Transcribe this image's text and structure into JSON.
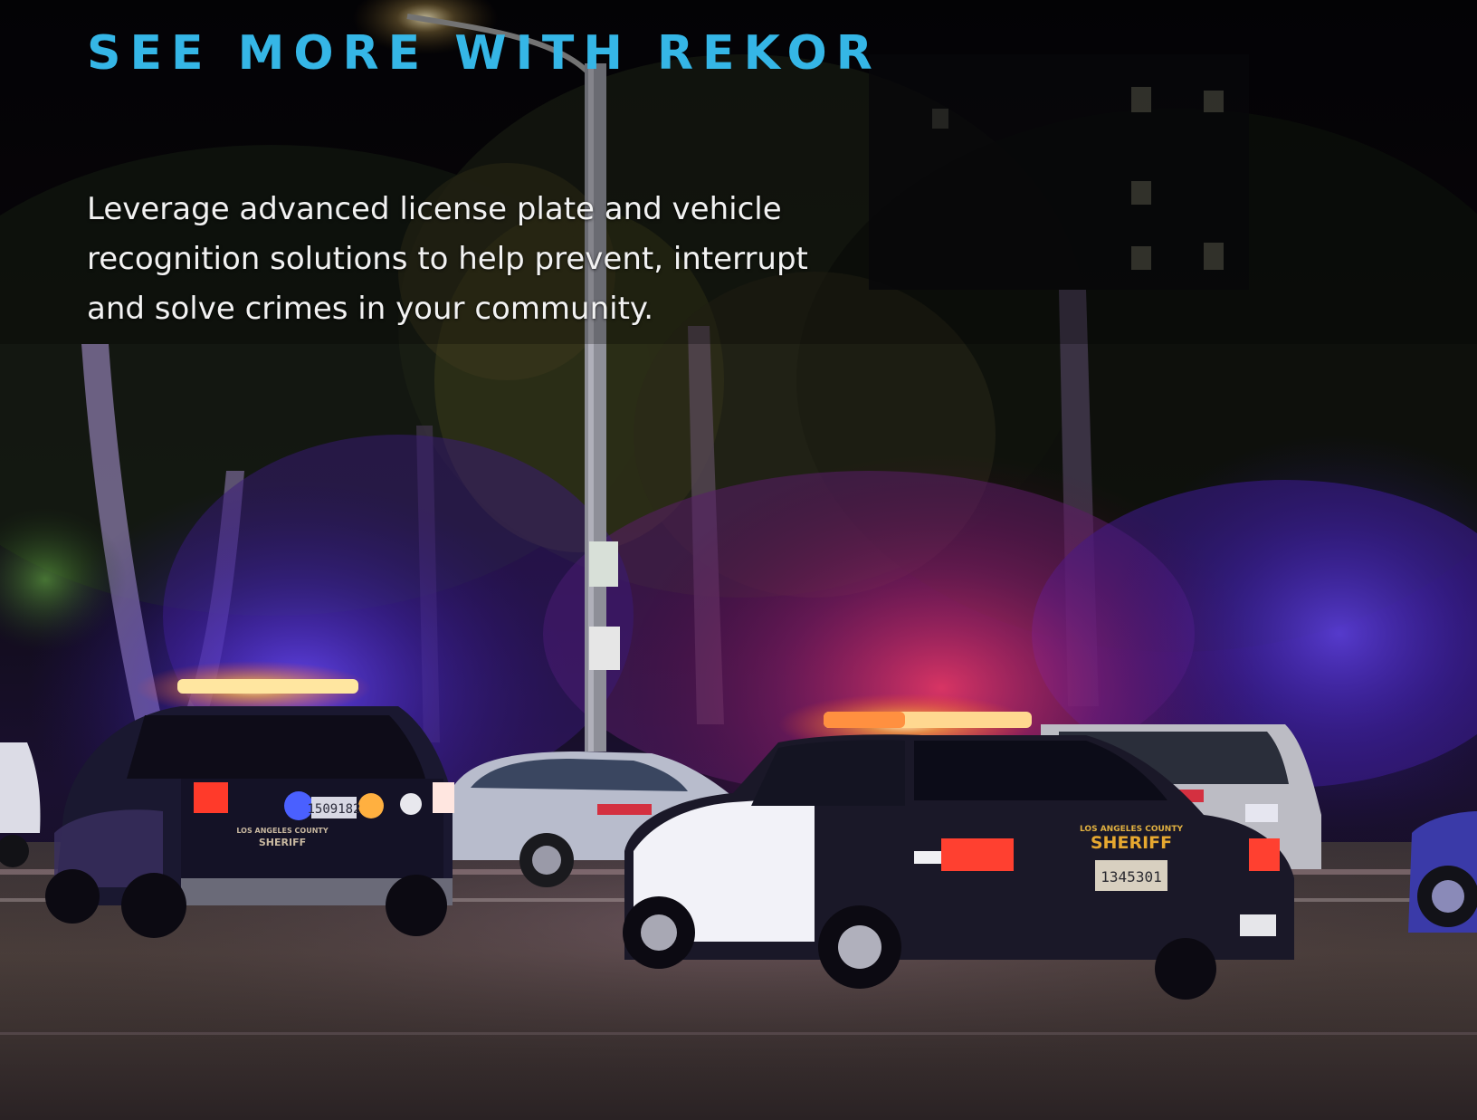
{
  "hero": {
    "headline": "SEE MORE WITH REKOR",
    "body_lines": [
      "Leverage advanced license plate and vehicle",
      "recognition solutions to help prevent, interrupt",
      "and solve crimes in your community."
    ]
  },
  "photo": {
    "left_suv": {
      "county_text": "LOS ANGELES COUNTY",
      "sheriff_text": "SHERIFF",
      "plate": "1509182"
    },
    "right_car": {
      "county_text": "LOS ANGELES COUNTY",
      "sheriff_text": "SHERIFF",
      "plate": "1345301"
    }
  },
  "colors": {
    "headline": "#35b6e6",
    "body_text": "#f2f2f2",
    "siren_blue": "#3a4bff",
    "siren_red": "#ff2a3a",
    "siren_amber": "#ffb03a"
  }
}
